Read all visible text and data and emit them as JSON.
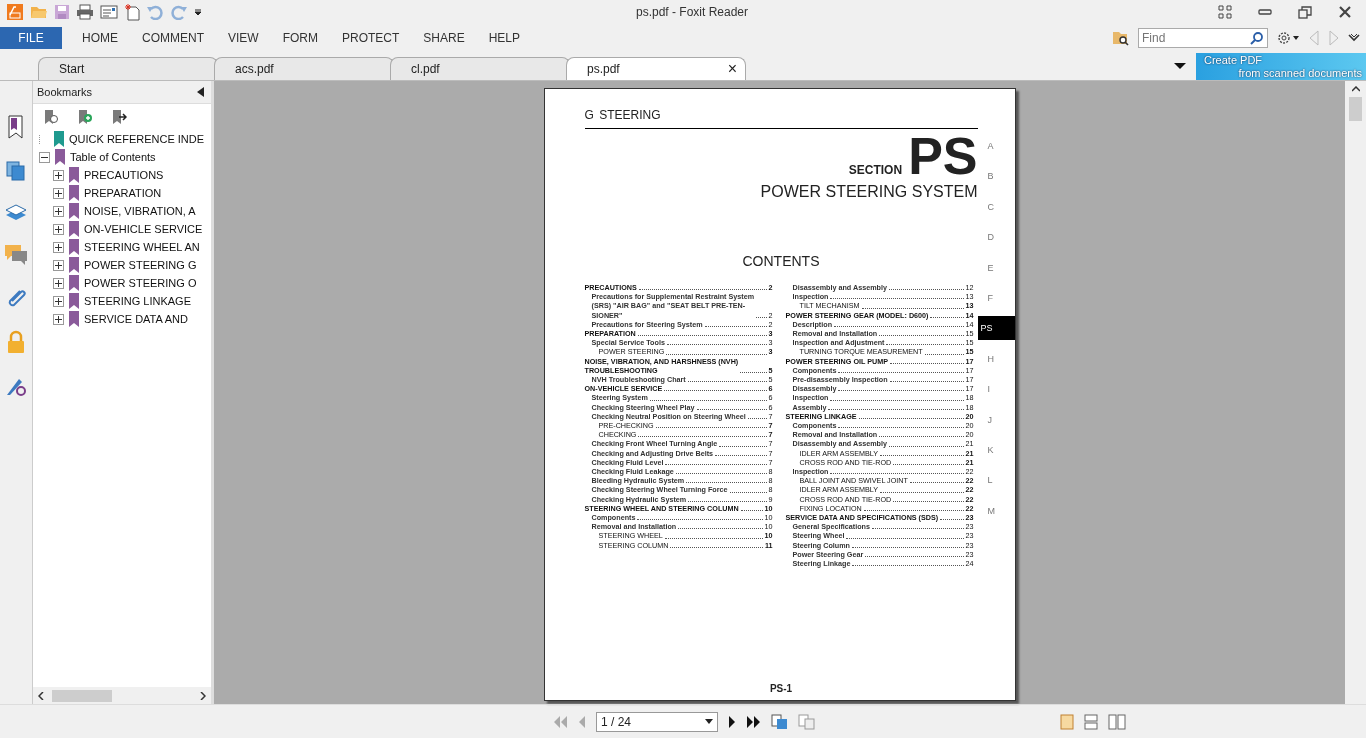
{
  "window": {
    "title": "ps.pdf - Foxit Reader"
  },
  "ribbon": {
    "file": "FILE",
    "menus": [
      {
        "label": "HOME",
        "selected": false
      },
      {
        "label": "COMMENT",
        "selected": false
      },
      {
        "label": "VIEW",
        "selected": false
      },
      {
        "label": "FORM",
        "selected": false
      },
      {
        "label": "PROTECT",
        "selected": false
      },
      {
        "label": "SHARE",
        "selected": false
      },
      {
        "label": "HELP",
        "selected": false
      }
    ],
    "search": {
      "placeholder": "Find"
    }
  },
  "tabs": [
    {
      "label": "Start",
      "selected": false
    },
    {
      "label": "acs.pdf",
      "selected": false
    },
    {
      "label": "cl.pdf",
      "selected": false
    },
    {
      "label": "ps.pdf",
      "selected": true,
      "close": "×"
    }
  ],
  "banner": {
    "line1": "Create PDF",
    "line2": "from scanned documents"
  },
  "bookmarks": {
    "title": "Bookmarks",
    "items": [
      {
        "label": "QUICK REFERENCE INDE"
      },
      {
        "label": "Table of Contents",
        "expanded": true,
        "children": [
          {
            "label": "PRECAUTIONS",
            "expanded": false
          },
          {
            "label": "PREPARATION",
            "expanded": false
          },
          {
            "label": "NOISE, VIBRATION, A",
            "expanded": false
          },
          {
            "label": "ON-VEHICLE SERVICE",
            "expanded": false
          },
          {
            "label": "STEERING WHEEL AN",
            "expanded": false
          },
          {
            "label": "POWER STEERING G",
            "expanded": false
          },
          {
            "label": "POWER STEERING O",
            "expanded": false
          },
          {
            "label": "STEERING LINKAGE",
            "expanded": false
          },
          {
            "label": "SERVICE DATA AND",
            "expanded": false
          }
        ]
      }
    ]
  },
  "page": {
    "header": "G  STEERING",
    "section_label": "SECTION",
    "section_code": "PS",
    "section_title": "POWER STEERING SYSTEM",
    "contents_title": "CONTENTS",
    "footer": "PS-1",
    "side_tabs": [
      {
        "label": "A",
        "selected": false
      },
      {
        "label": "B",
        "selected": false
      },
      {
        "label": "C",
        "selected": false
      },
      {
        "label": "D",
        "selected": false
      },
      {
        "label": "E",
        "selected": false
      },
      {
        "label": "F",
        "selected": false
      },
      {
        "label": "PS",
        "selected": true
      },
      {
        "label": "H",
        "selected": false
      },
      {
        "label": "I",
        "selected": false
      },
      {
        "label": "J",
        "selected": false
      },
      {
        "label": "K",
        "selected": false
      },
      {
        "label": "L",
        "selected": false
      },
      {
        "label": "M",
        "selected": false
      }
    ],
    "columns": [
      [
        {
          "kind": "heading",
          "text": "PRECAUTIONS",
          "page": "2"
        },
        {
          "kind": "item",
          "text": "Precautions for Supplemental Restraint System\n(SRS) \"AIR BAG\" and \"SEAT BELT PRE-TEN-\nSIONER\"",
          "page": "2"
        },
        {
          "kind": "item",
          "text": "Precautions for Steering System",
          "page": "2"
        },
        {
          "kind": "heading",
          "text": "PREPARATION",
          "page": "3"
        },
        {
          "kind": "item",
          "text": "Special Service Tools",
          "page": "3"
        },
        {
          "kind": "subitem",
          "text": "POWER STEERING",
          "page": "3"
        },
        {
          "kind": "heading",
          "text": "NOISE, VIBRATION, AND HARSHNESS (NVH)\nTROUBLESHOOTING",
          "page": "5"
        },
        {
          "kind": "item",
          "text": "NVH Troubleshooting Chart",
          "page": "5"
        },
        {
          "kind": "heading",
          "text": "ON-VEHICLE SERVICE",
          "page": "6"
        },
        {
          "kind": "item",
          "text": "Steering System",
          "page": "6"
        },
        {
          "kind": "item",
          "text": "Checking Steering Wheel Play",
          "page": "6"
        },
        {
          "kind": "item",
          "text": "Checking Neutral Position on Steering Wheel",
          "page": "7"
        },
        {
          "kind": "subitem",
          "text": "PRE-CHECKING",
          "page": "7"
        },
        {
          "kind": "subitem",
          "text": "CHECKING",
          "page": "7"
        },
        {
          "kind": "item",
          "text": "Checking Front Wheel Turning Angle",
          "page": "7"
        },
        {
          "kind": "item",
          "text": "Checking and Adjusting Drive Belts",
          "page": "7"
        },
        {
          "kind": "item",
          "text": "Checking Fluid Level",
          "page": "7"
        },
        {
          "kind": "item",
          "text": "Checking Fluid Leakage",
          "page": "8"
        },
        {
          "kind": "item",
          "text": "Bleeding Hydraulic System",
          "page": "8"
        },
        {
          "kind": "item",
          "text": "Checking Steering Wheel Turning Force",
          "page": "8"
        },
        {
          "kind": "item",
          "text": "Checking Hydraulic System",
          "page": "9"
        },
        {
          "kind": "heading",
          "text": "STEERING WHEEL AND STEERING COLUMN",
          "page": "10"
        },
        {
          "kind": "item",
          "text": "Components",
          "page": "10"
        },
        {
          "kind": "item",
          "text": "Removal and Installation",
          "page": "10"
        },
        {
          "kind": "subitem",
          "text": "STEERING WHEEL",
          "page": "10"
        },
        {
          "kind": "subitem",
          "text": "STEERING COLUMN",
          "page": "11"
        }
      ],
      [
        {
          "kind": "item",
          "text": "Disassembly and Assembly",
          "page": "12"
        },
        {
          "kind": "item",
          "text": "Inspection",
          "page": "13"
        },
        {
          "kind": "subitem",
          "text": "TILT MECHANISM",
          "page": "13"
        },
        {
          "kind": "heading",
          "text": "POWER STEERING GEAR (MODEL: D600)",
          "page": "14"
        },
        {
          "kind": "item",
          "text": "Description",
          "page": "14"
        },
        {
          "kind": "item",
          "text": "Removal and Installation",
          "page": "15"
        },
        {
          "kind": "item",
          "text": "Inspection and Adjustment",
          "page": "15"
        },
        {
          "kind": "subitem",
          "text": "TURNING TORQUE MEASUREMENT",
          "page": "15"
        },
        {
          "kind": "heading",
          "text": "POWER STEERING OIL PUMP",
          "page": "17"
        },
        {
          "kind": "item",
          "text": "Components",
          "page": "17"
        },
        {
          "kind": "item",
          "text": "Pre-disassembly Inspection",
          "page": "17"
        },
        {
          "kind": "item",
          "text": "Disassembly",
          "page": "17"
        },
        {
          "kind": "item",
          "text": "Inspection",
          "page": "18"
        },
        {
          "kind": "item",
          "text": "Assembly",
          "page": "18"
        },
        {
          "kind": "heading",
          "text": "STEERING LINKAGE",
          "page": "20"
        },
        {
          "kind": "item",
          "text": "Components",
          "page": "20"
        },
        {
          "kind": "item",
          "text": "Removal and Installation",
          "page": "20"
        },
        {
          "kind": "item",
          "text": "Disassembly and Assembly",
          "page": "21"
        },
        {
          "kind": "subitem",
          "text": "IDLER ARM ASSEMBLY",
          "page": "21"
        },
        {
          "kind": "subitem",
          "text": "CROSS ROD AND TIE-ROD",
          "page": "21"
        },
        {
          "kind": "item",
          "text": "Inspection",
          "page": "22"
        },
        {
          "kind": "subitem",
          "text": "BALL JOINT AND SWIVEL JOINT",
          "page": "22"
        },
        {
          "kind": "subitem",
          "text": "IDLER ARM ASSEMBLY",
          "page": "22"
        },
        {
          "kind": "subitem",
          "text": "CROSS ROD AND TIE-ROD",
          "page": "22"
        },
        {
          "kind": "subitem",
          "text": "FIXING LOCATION",
          "page": "22"
        },
        {
          "kind": "heading",
          "text": "SERVICE DATA AND SPECIFICATIONS (SDS)",
          "page": "23"
        },
        {
          "kind": "item",
          "text": "General Specifications",
          "page": "23"
        },
        {
          "kind": "item",
          "text": "Steering Wheel",
          "page": "23"
        },
        {
          "kind": "item",
          "text": "Steering Column",
          "page": "23"
        },
        {
          "kind": "item",
          "text": "Power Steering Gear",
          "page": "23"
        },
        {
          "kind": "item",
          "text": "Steering Linkage",
          "page": "24"
        }
      ]
    ]
  },
  "status_bar": {
    "page_field": "1 / 24"
  }
}
